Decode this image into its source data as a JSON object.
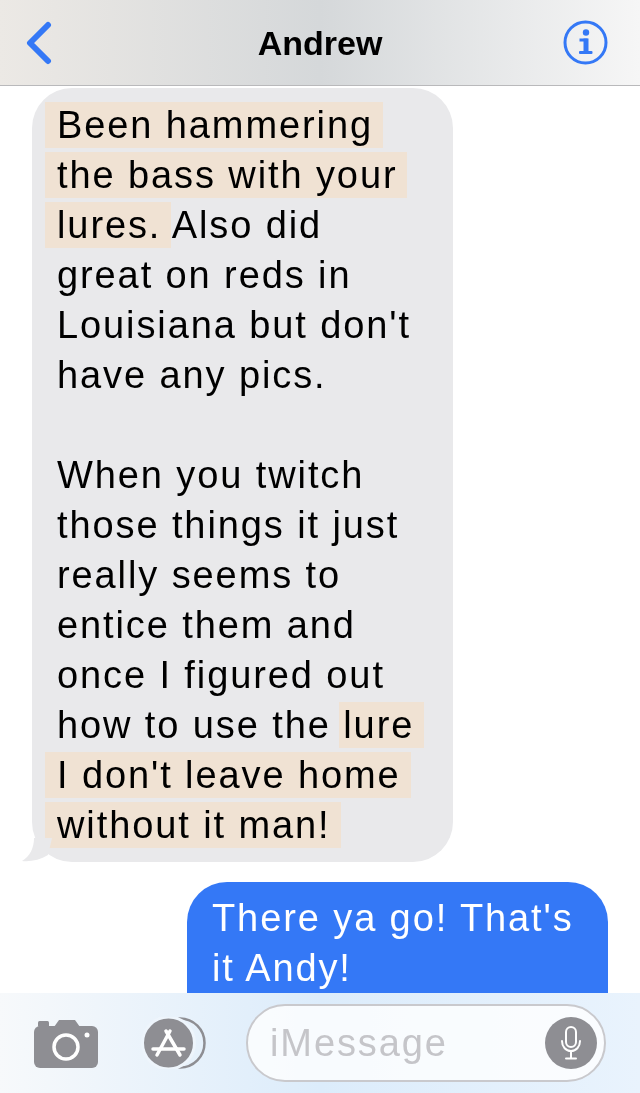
{
  "header": {
    "title": "Andrew"
  },
  "messages": [
    {
      "kind": "received",
      "paragraphs": [
        {
          "lines": [
            {
              "segments": [
                {
                  "text": "Been hammering",
                  "highlighted": true
                }
              ]
            },
            {
              "segments": [
                {
                  "text": "the bass with your",
                  "highlighted": true
                }
              ]
            },
            {
              "segments": [
                {
                  "text": "lures.",
                  "highlighted": true
                },
                {
                  "text": "Also did",
                  "highlighted": false
                }
              ]
            },
            {
              "segments": [
                {
                  "text": "great on reds in",
                  "highlighted": false
                }
              ]
            },
            {
              "segments": [
                {
                  "text": "Louisiana but don't",
                  "highlighted": false
                }
              ]
            },
            {
              "segments": [
                {
                  "text": "have any pics.",
                  "highlighted": false
                }
              ]
            }
          ]
        },
        {
          "lines": [
            {
              "segments": [
                {
                  "text": "When you twitch",
                  "highlighted": false
                }
              ]
            },
            {
              "segments": [
                {
                  "text": "those things it just",
                  "highlighted": false
                }
              ]
            },
            {
              "segments": [
                {
                  "text": "really seems to",
                  "highlighted": false
                }
              ]
            },
            {
              "segments": [
                {
                  "text": "entice them and",
                  "highlighted": false
                }
              ]
            },
            {
              "segments": [
                {
                  "text": "once I figured out",
                  "highlighted": false
                }
              ]
            },
            {
              "segments": [
                {
                  "text": "how to use the",
                  "highlighted": false
                },
                {
                  "text": "lure",
                  "highlighted": true
                }
              ]
            },
            {
              "segments": [
                {
                  "text": "I don't leave home",
                  "highlighted": true
                }
              ]
            },
            {
              "segments": [
                {
                  "text": "without it man!",
                  "highlighted": true
                }
              ]
            }
          ]
        }
      ]
    },
    {
      "kind": "sent",
      "paragraphs": [
        {
          "lines": [
            {
              "segments": [
                {
                  "text": "There ya go! That's",
                  "highlighted": false
                }
              ]
            },
            {
              "segments": [
                {
                  "text": "it Andy!",
                  "highlighted": false
                }
              ]
            }
          ]
        }
      ]
    }
  ],
  "composer": {
    "placeholder": "iMessage"
  }
}
